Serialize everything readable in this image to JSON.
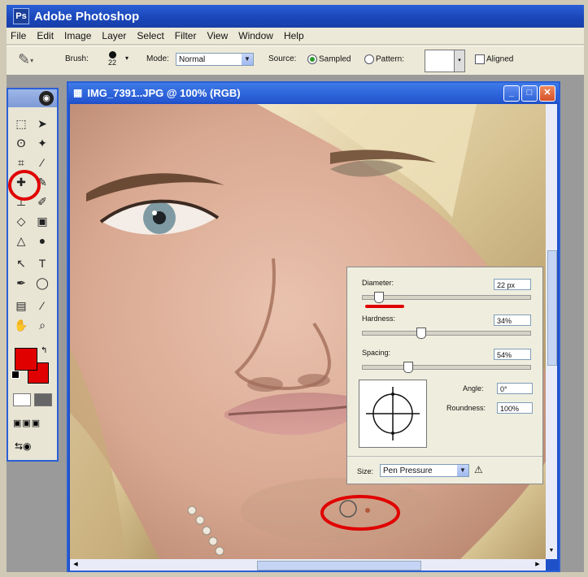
{
  "app": {
    "title": "Adobe Photoshop"
  },
  "menu": [
    "File",
    "Edit",
    "Image",
    "Layer",
    "Select",
    "Filter",
    "View",
    "Window",
    "Help"
  ],
  "options": {
    "brush_label": "Brush:",
    "brush_size": "22",
    "mode_label": "Mode:",
    "mode_value": "Normal",
    "source_label": "Source:",
    "sampled_label": "Sampled",
    "pattern_label": "Pattern:",
    "aligned_label": "Aligned"
  },
  "document": {
    "title": "IMG_7391..JPG @ 100% (RGB)"
  },
  "brush_panel": {
    "diameter_label": "Diameter:",
    "diameter_value": "22 px",
    "hardness_label": "Hardness:",
    "hardness_value": "34%",
    "spacing_label": "Spacing:",
    "spacing_value": "54%",
    "angle_label": "Angle:",
    "angle_value": "0°",
    "roundness_label": "Roundness:",
    "roundness_value": "100%",
    "size_label": "Size:",
    "size_value": "Pen Pressure"
  },
  "colors": {
    "title_blue": "#2a5fd6",
    "foreground": "#e00000",
    "background": "#e00000",
    "annotation_red": "#e00000"
  }
}
